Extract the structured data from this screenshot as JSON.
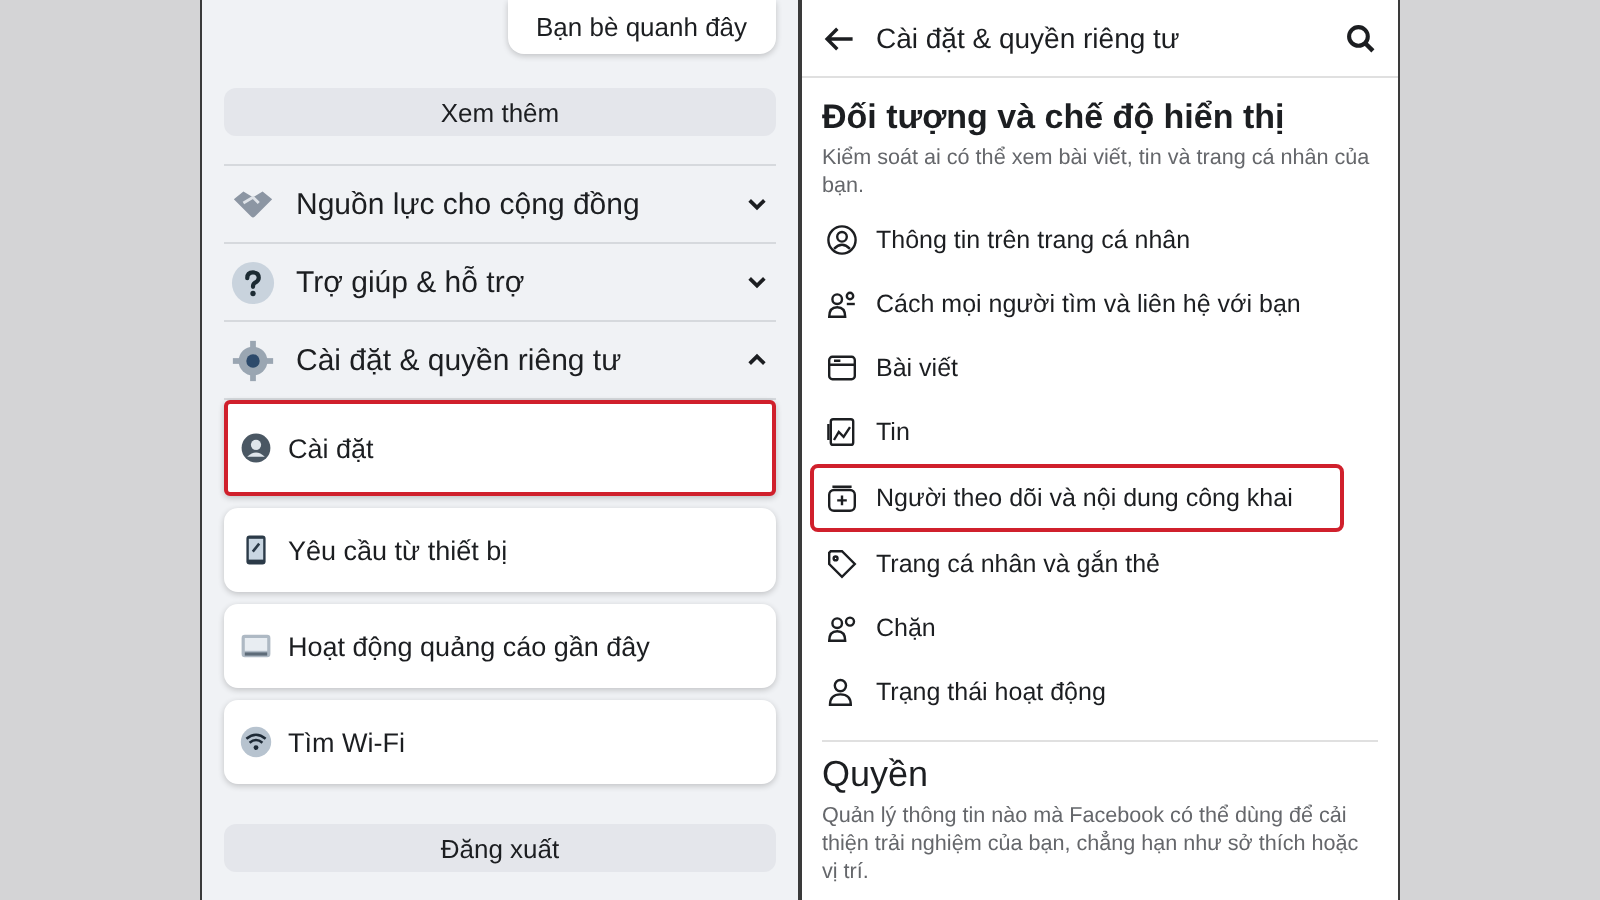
{
  "left_panel": {
    "nearby_card": "Bạn bè quanh đây",
    "see_more_button": "Xem thêm",
    "sections": [
      {
        "label": "Nguồn lực cho cộng đồng",
        "expanded": false
      },
      {
        "label": "Trợ giúp & hỗ trợ",
        "expanded": false
      },
      {
        "label": "Cài đặt & quyền riêng tư",
        "expanded": true,
        "items": [
          {
            "label": "Cài đặt",
            "highlighted": true
          },
          {
            "label": "Yêu cầu từ thiết bị",
            "highlighted": false
          },
          {
            "label": "Hoạt động quảng cáo gần đây",
            "highlighted": false
          },
          {
            "label": "Tìm Wi-Fi",
            "highlighted": false
          }
        ]
      }
    ],
    "logout_button": "Đăng xuất"
  },
  "right_panel": {
    "title": "Cài đặt & quyền riêng tư",
    "sections": [
      {
        "heading": "Đối tượng và chế độ hiển thị",
        "description": "Kiểm soát ai có thể xem bài viết, tin và trang cá nhân của bạn.",
        "items": [
          {
            "label": "Thông tin trên trang cá nhân",
            "highlighted": false
          },
          {
            "label": "Cách mọi người tìm và liên hệ với bạn",
            "highlighted": false
          },
          {
            "label": "Bài viết",
            "highlighted": false
          },
          {
            "label": "Tin",
            "highlighted": false
          },
          {
            "label": "Người theo dõi và nội dung công khai",
            "highlighted": true
          },
          {
            "label": "Trang cá nhân và gắn thẻ",
            "highlighted": false
          },
          {
            "label": "Chặn",
            "highlighted": false
          },
          {
            "label": "Trạng thái hoạt động",
            "highlighted": false
          }
        ]
      },
      {
        "heading": "Quyền",
        "description": "Quản lý thông tin nào mà Facebook có thể dùng để cải thiện trải nghiệm của bạn, chẳng hạn như sở thích hoặc vị trí."
      }
    ]
  }
}
